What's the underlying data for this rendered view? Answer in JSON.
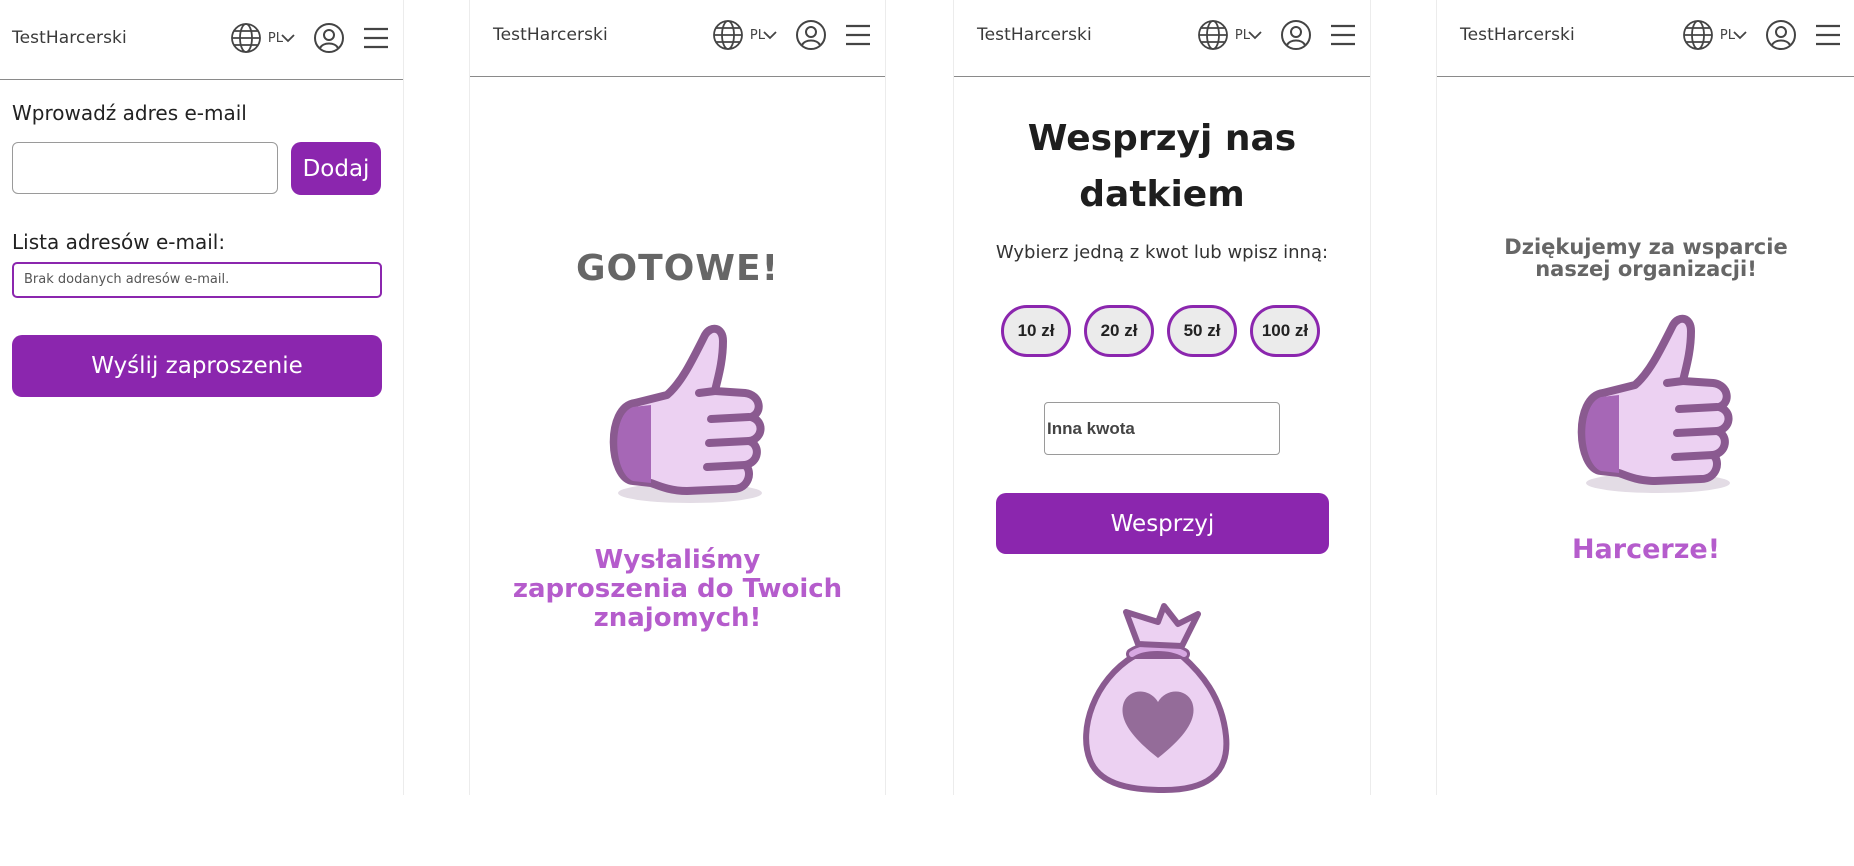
{
  "brand": "TestHarcerski",
  "lang": "PL",
  "icons": {
    "lang": "globe-icon",
    "dropdown": "chevron-down-icon",
    "account": "user-circle-icon",
    "menu": "hamburger-menu-icon"
  },
  "colors": {
    "accent": "#8b26ae",
    "accent_light": "#b55ccc",
    "thumb_fill": "#ecd1f2",
    "thumb_stroke": "#8a5a90"
  },
  "screen1": {
    "email_label": "Wprowadź adres e-mail",
    "email_value": "",
    "add_button": "Dodaj",
    "list_label": "Lista adresów e-mail:",
    "list_empty": "Brak dodanych adresów e-mail.",
    "send_button": "Wyślij zaproszenie"
  },
  "screen2": {
    "title": "GOTOWE!",
    "message": "Wysłaliśmy zaproszenia do Twoich znajomych!"
  },
  "screen3": {
    "title_line1": "Wesprzyj nas",
    "title_line2": "datkiem",
    "subtitle": "Wybierz jedną z kwot lub wpisz inną:",
    "amounts": [
      "10 zł",
      "20 zł",
      "50 zł",
      "100 zł"
    ],
    "other_placeholder": "Inna kwota",
    "support_button": "Wesprzyj"
  },
  "screen4": {
    "thanks": "Dziękujemy za wsparcie naszej organizacji!",
    "closing": "Harcerze!"
  }
}
